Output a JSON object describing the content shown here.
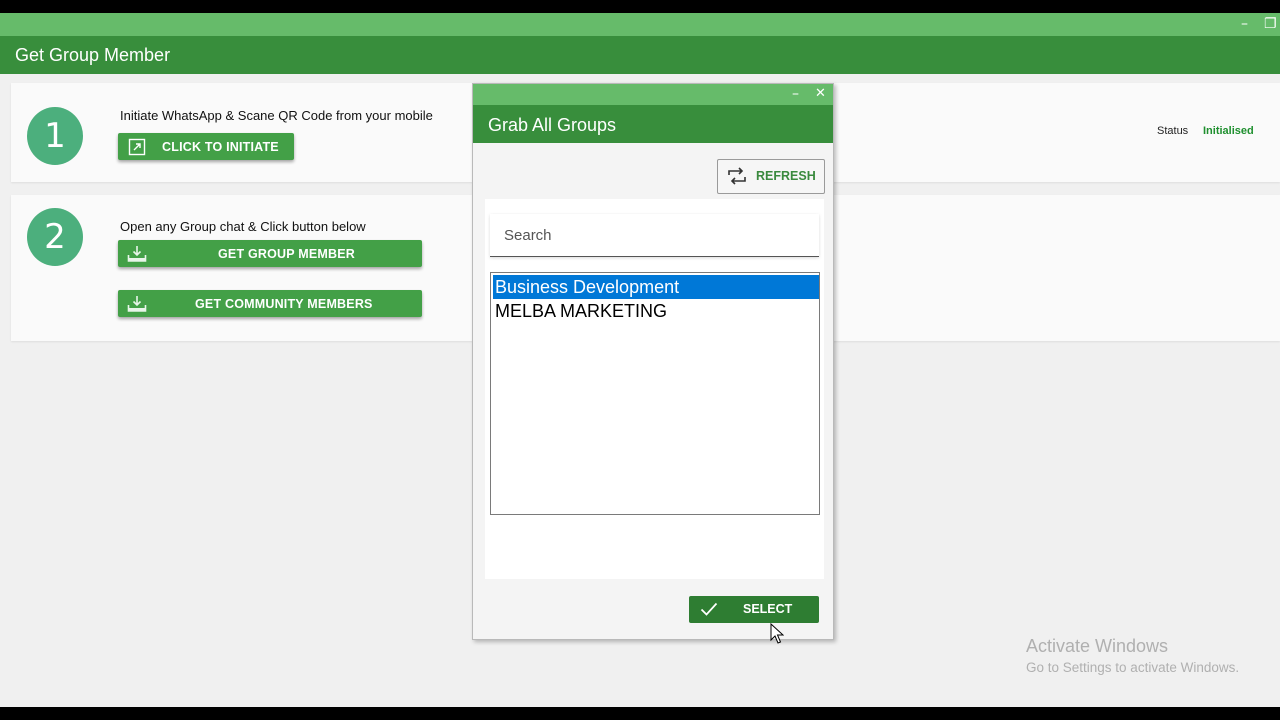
{
  "window": {
    "title": "Get Group Member",
    "minimize_glyph": "–",
    "restore_glyph": "❐"
  },
  "step1": {
    "number": "1",
    "instruction": "Initiate WhatsApp & Scane QR Code from your mobile",
    "button_label": "CLICK TO INITIATE",
    "button_icon": "external-link-icon"
  },
  "step2": {
    "number": "2",
    "instruction": "Open any Group chat & Click button below",
    "group_button_label": "GET GROUP MEMBER",
    "community_button_label": "GET COMMUNITY MEMBERS",
    "button_icon": "download-tray-icon"
  },
  "status": {
    "label": "Status",
    "value": "Initialised",
    "value_color": "#1e8f2e"
  },
  "dialog": {
    "title": "Grab All Groups",
    "minimize_glyph": "–",
    "close_glyph": "✕",
    "refresh_label": "REFRESH",
    "refresh_icon": "refresh-icon",
    "search": {
      "placeholder": "Search",
      "value": ""
    },
    "groups": [
      {
        "name": "Business Development",
        "selected": true
      },
      {
        "name": "MELBA MARKETING",
        "selected": false
      }
    ],
    "select_label": "SELECT",
    "select_icon": "check-icon"
  },
  "watermark": {
    "line1": "Activate Windows",
    "line2": "Go to Settings to activate Windows."
  },
  "colors": {
    "titlebar": "#66bb6a",
    "header": "#388e3c",
    "button": "#43a047",
    "step_circle": "#4caf7d",
    "selection": "#0078d7"
  }
}
